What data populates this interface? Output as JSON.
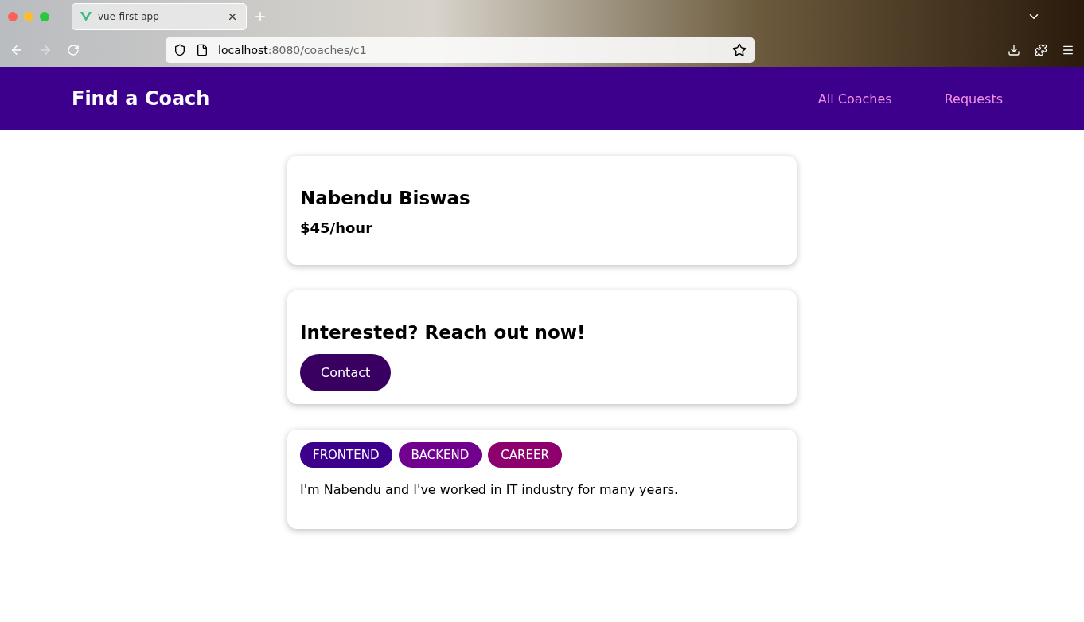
{
  "browser": {
    "tab_title": "vue-first-app",
    "url_host": "localhost",
    "url_path": ":8080/coaches/c1"
  },
  "header": {
    "title": "Find a Coach",
    "nav": [
      "All Coaches",
      "Requests"
    ]
  },
  "coach": {
    "name": "Nabendu Biswas",
    "rate": "$45/hour"
  },
  "contact": {
    "heading": "Interested? Reach out now!",
    "button": "Contact"
  },
  "areas": [
    {
      "label": "FRONTEND",
      "color": "#3d008d"
    },
    {
      "label": "BACKEND",
      "color": "#71008f"
    },
    {
      "label": "CAREER",
      "color": "#8d006e"
    }
  ],
  "description": "I'm Nabendu and I've worked in IT industry for many years."
}
